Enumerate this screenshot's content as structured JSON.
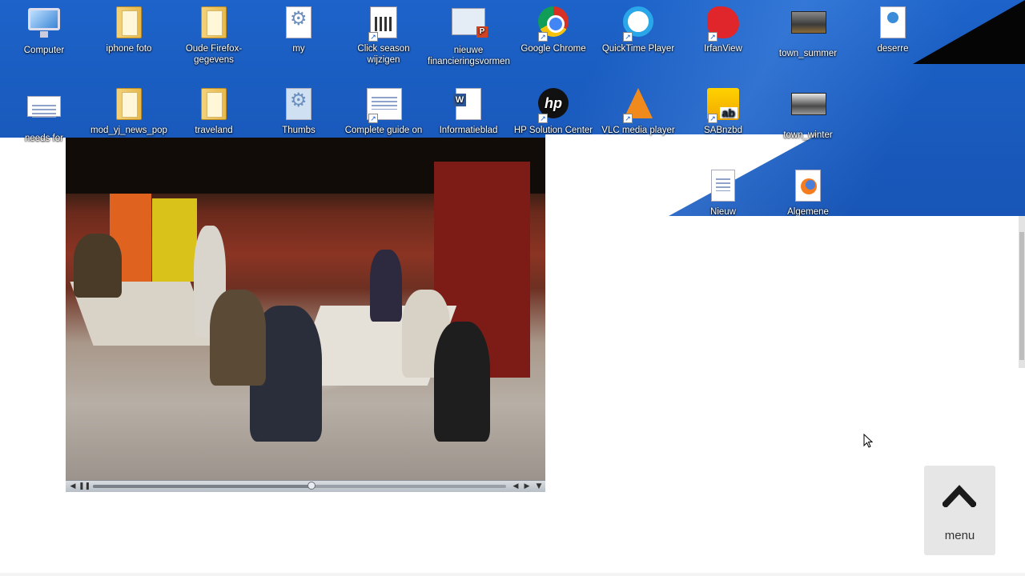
{
  "desktop": {
    "icons": [
      {
        "label": "Computer",
        "icon": "computer-icon"
      },
      {
        "label": "iphone foto",
        "icon": "folder-icon"
      },
      {
        "label": "Oude Firefox-gegevens",
        "icon": "folder-icon"
      },
      {
        "label": "my",
        "icon": "settings-file-icon"
      },
      {
        "label": "Click season wijzigen",
        "icon": "calendar-shortcut-icon"
      },
      {
        "label": "nieuwe financieringsvormen",
        "icon": "powerpoint-file-icon"
      },
      {
        "label": "Google Chrome",
        "icon": "chrome-icon"
      },
      {
        "label": "QuickTime Player",
        "icon": "quicktime-icon"
      },
      {
        "label": "IrfanView",
        "icon": "irfanview-icon"
      },
      {
        "label": "town_summer",
        "icon": "image-file-icon"
      },
      {
        "label": "deserre",
        "icon": "web-file-icon"
      },
      {
        "label": "needs for",
        "icon": "document-icon"
      },
      {
        "label": "mod_yj_news_pop",
        "icon": "folder-icon"
      },
      {
        "label": "traveland",
        "icon": "folder-icon"
      },
      {
        "label": "Thumbs",
        "icon": "settings-file-icon"
      },
      {
        "label": "Complete guide on",
        "icon": "document-shortcut-icon"
      },
      {
        "label": "Informatieblad",
        "icon": "word-file-icon"
      },
      {
        "label": "HP Solution Center",
        "icon": "hp-icon"
      },
      {
        "label": "VLC media player",
        "icon": "vlc-icon"
      },
      {
        "label": "SABnzbd",
        "icon": "sabnzbd-icon"
      },
      {
        "label": "town_winter",
        "icon": "image-file-icon"
      },
      {
        "label": "Nieuw",
        "icon": "document-icon"
      },
      {
        "label": "Algemene",
        "icon": "firefox-file-icon"
      }
    ]
  },
  "player": {
    "progress": 0.53
  },
  "menu_button": {
    "label": "menu"
  },
  "colors": {
    "desktop_blue": "#1a5cc0",
    "menu_bg": "#e6e6e6",
    "player_bar": "#c8cdd3"
  }
}
